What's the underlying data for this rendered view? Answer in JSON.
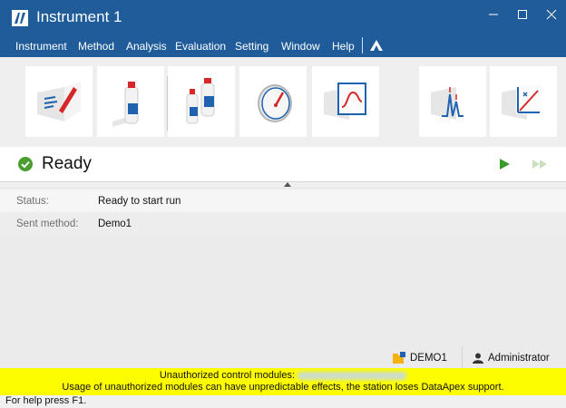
{
  "window": {
    "title": "Instrument 1",
    "controls": [
      "minimize-icon",
      "maximize-icon",
      "close-icon"
    ]
  },
  "menu": {
    "items": [
      "Instrument",
      "Method",
      "Analysis",
      "Evaluation",
      "Setting",
      "Window",
      "Help"
    ]
  },
  "toolbar": {
    "tiles": [
      "method-edit-icon",
      "single-analysis-icon",
      "sequence-icon",
      "device-monitor-icon",
      "data-acquisition-icon",
      "chromatogram-icon",
      "calibration-icon"
    ]
  },
  "status_header": {
    "state": "Ready",
    "icon": "check-circle-icon",
    "accent": "#4a9e2f"
  },
  "info": {
    "rows": [
      {
        "label": "Status:",
        "value": "Ready to start run"
      },
      {
        "label": "Sent method:",
        "value": "Demo1"
      }
    ]
  },
  "footer": {
    "project": "DEMO1",
    "user": "Administrator"
  },
  "warning": {
    "line1_prefix": "Unauthorized control modules:",
    "line2": "Usage of unauthorized modules can have unpredictable effects, the station loses DataApex support.",
    "background": "#fdfd00"
  },
  "statusbar": {
    "text": "For help press F1."
  },
  "colors": {
    "titlebar": "#1f5c99",
    "tile_accent_red": "#d62828",
    "tile_accent_blue": "#1e62b0"
  }
}
